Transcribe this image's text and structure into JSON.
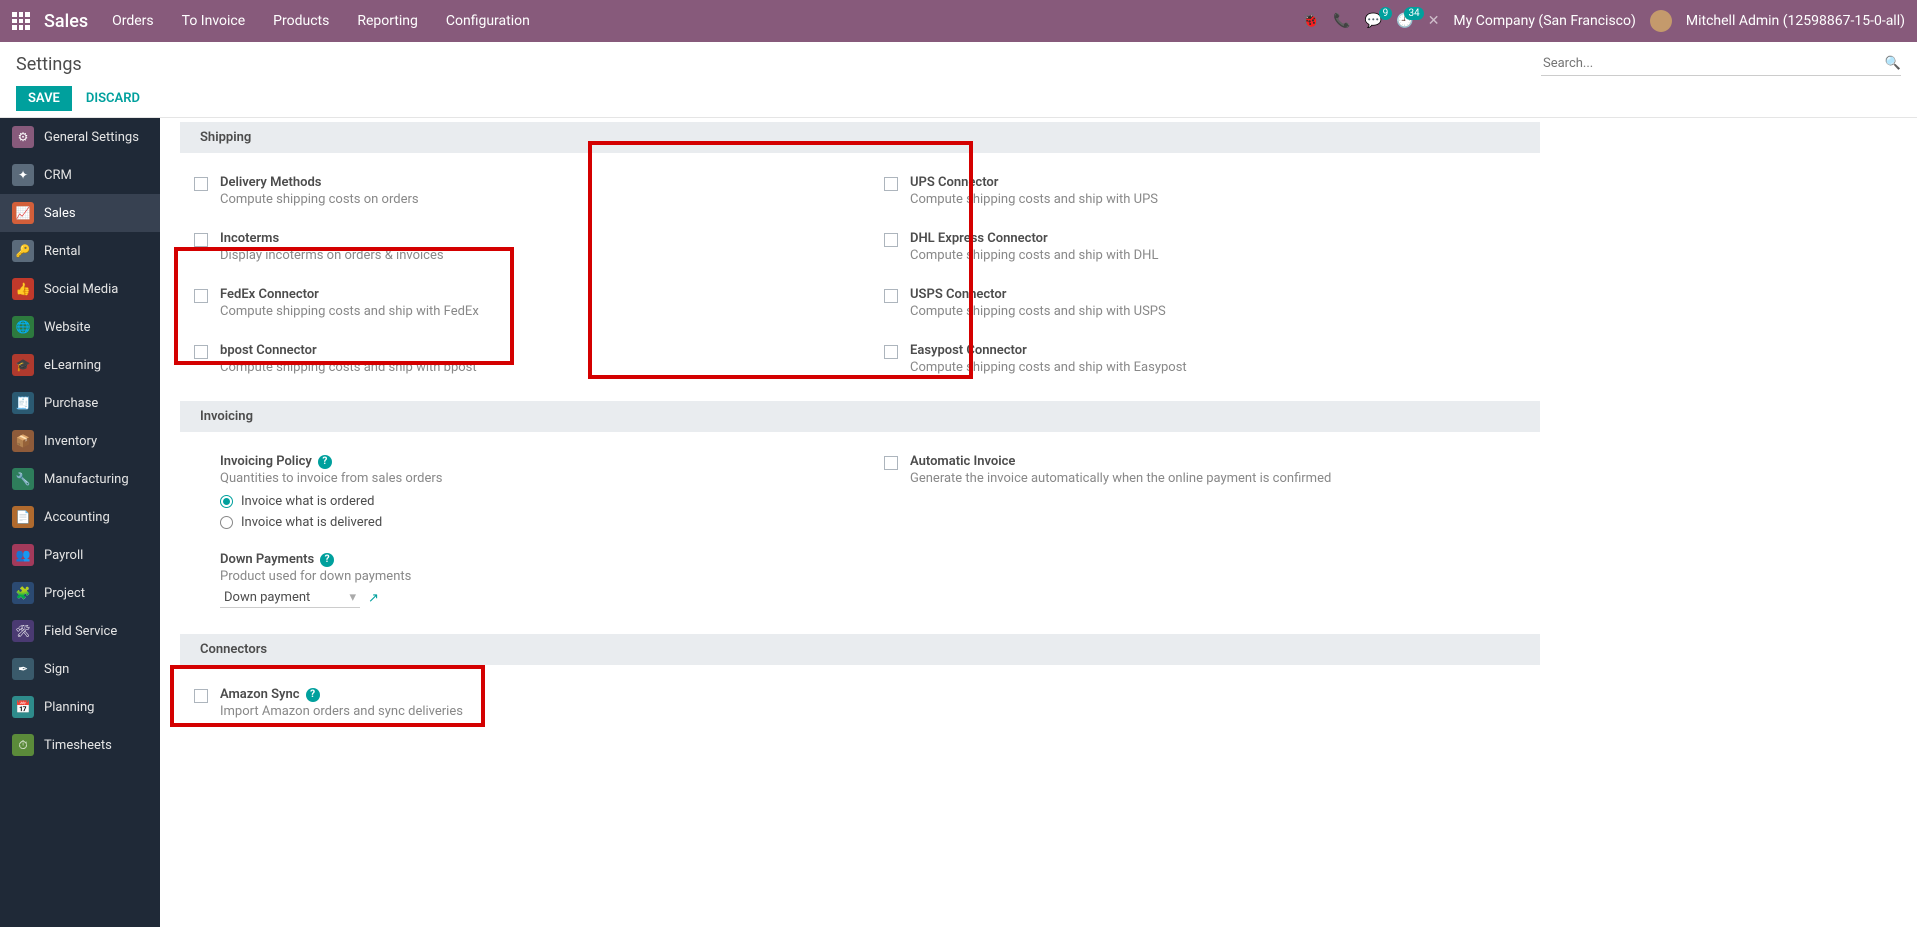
{
  "topnav": {
    "brand": "Sales",
    "menu": [
      "Orders",
      "To Invoice",
      "Products",
      "Reporting",
      "Configuration"
    ],
    "chat_badge": "9",
    "clock_badge": "34",
    "company": "My Company (San Francisco)",
    "user": "Mitchell Admin (12598867-15-0-all)"
  },
  "controlbar": {
    "title": "Settings",
    "search_placeholder": "Search...",
    "save": "SAVE",
    "discard": "DISCARD"
  },
  "sidebar": [
    {
      "label": "General Settings",
      "color": "#875a7b",
      "glyph": "⚙"
    },
    {
      "label": "CRM",
      "color": "#5b6b7b",
      "glyph": "✦"
    },
    {
      "label": "Sales",
      "color": "#d35f3a",
      "glyph": "📈",
      "active": true
    },
    {
      "label": "Rental",
      "color": "#5b6b7b",
      "glyph": "🔑"
    },
    {
      "label": "Social Media",
      "color": "#c0392b",
      "glyph": "👍"
    },
    {
      "label": "Website",
      "color": "#2d7a3e",
      "glyph": "🌐"
    },
    {
      "label": "eLearning",
      "color": "#b03a2e",
      "glyph": "🎓"
    },
    {
      "label": "Purchase",
      "color": "#2b5a72",
      "glyph": "🧾"
    },
    {
      "label": "Inventory",
      "color": "#8e5b3a",
      "glyph": "📦"
    },
    {
      "label": "Manufacturing",
      "color": "#2e7d5b",
      "glyph": "🔧"
    },
    {
      "label": "Accounting",
      "color": "#b06a2e",
      "glyph": "📄"
    },
    {
      "label": "Payroll",
      "color": "#a33a5b",
      "glyph": "👥"
    },
    {
      "label": "Project",
      "color": "#2b4a72",
      "glyph": "🧩"
    },
    {
      "label": "Field Service",
      "color": "#4a3a72",
      "glyph": "🛠"
    },
    {
      "label": "Sign",
      "color": "#3a5a6b",
      "glyph": "✒"
    },
    {
      "label": "Planning",
      "color": "#2e8b8b",
      "glyph": "📅"
    },
    {
      "label": "Timesheets",
      "color": "#5b8b3a",
      "glyph": "⏱"
    }
  ],
  "sections": {
    "shipping": {
      "title": "Shipping",
      "left": [
        {
          "title": "Delivery Methods",
          "desc": "Compute shipping costs on orders"
        },
        {
          "title": "Incoterms",
          "desc": "Display incoterms on orders & invoices"
        },
        {
          "title": "FedEx Connector",
          "desc": "Compute shipping costs and ship with FedEx"
        },
        {
          "title": "bpost Connector",
          "desc": "Compute shipping costs and ship with bpost"
        }
      ],
      "right": [
        {
          "title": "UPS Connector",
          "desc": "Compute shipping costs and ship with UPS"
        },
        {
          "title": "DHL Express Connector",
          "desc": "Compute shipping costs and ship with DHL"
        },
        {
          "title": "USPS Connector",
          "desc": "Compute shipping costs and ship with USPS"
        },
        {
          "title": "Easypost Connector",
          "desc": "Compute shipping costs and ship with Easypost"
        }
      ]
    },
    "invoicing": {
      "title": "Invoicing",
      "policy": {
        "title": "Invoicing Policy",
        "desc": "Quantities to invoice from sales orders",
        "options": [
          "Invoice what is ordered",
          "Invoice what is delivered"
        ],
        "selected": 0
      },
      "down": {
        "title": "Down Payments",
        "desc": "Product used for down payments",
        "value": "Down payment"
      },
      "auto": {
        "title": "Automatic Invoice",
        "desc": "Generate the invoice automatically when the online payment is confirmed"
      }
    },
    "connectors": {
      "title": "Connectors",
      "amazon": {
        "title": "Amazon Sync",
        "desc": "Import Amazon orders and sync deliveries"
      }
    }
  }
}
